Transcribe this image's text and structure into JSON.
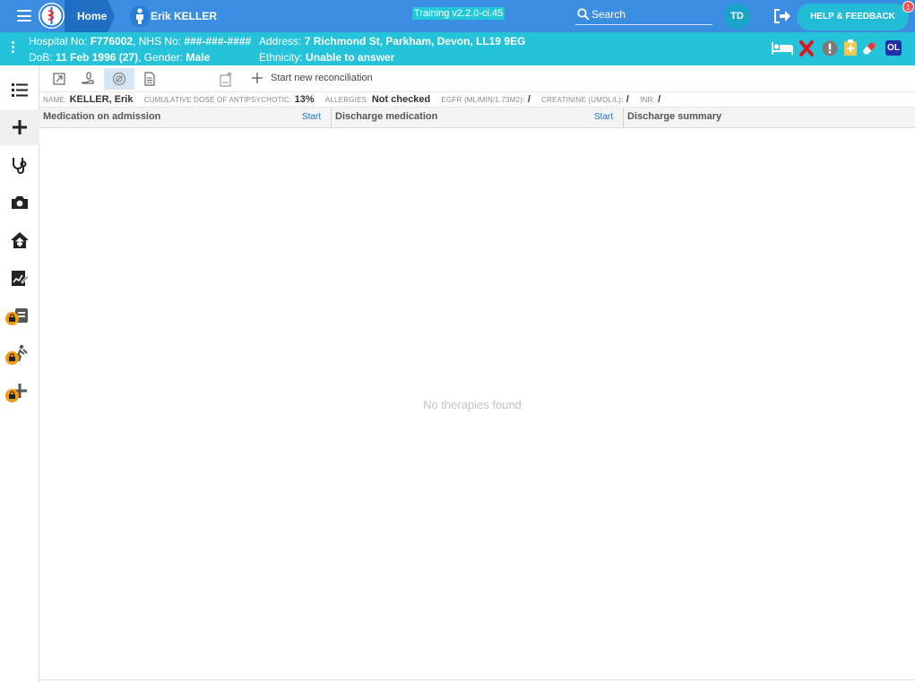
{
  "header": {
    "home_label": "Home",
    "patient_name": "Erik KELLER",
    "training_label": "Training v2.2.0-ci.45",
    "search_label": "Search",
    "user_initials": "TD",
    "help_label": "HELP & FEEDBACK",
    "help_badge_count": "1"
  },
  "banner": {
    "hospital_label": "Hospital No:",
    "hospital_no": "F776002",
    "nhs_label": "NHS No:",
    "nhs_no": "###-###-####",
    "dob_label": "DoB:",
    "dob": "11 Feb 1996 (27)",
    "gender_label": "Gender:",
    "gender": "Male",
    "address_label": "Address:",
    "address": "7 Richmond St, Parkham, Devon, LL19 9EG",
    "ethnicity_label": "Ethnicity:",
    "ethnicity": "Unable to answer",
    "ol_label": "OL"
  },
  "toolbar": {
    "start_recon_label": "Start new reconciliation"
  },
  "info": {
    "name_label": "NAME:",
    "name": "KELLER, Erik",
    "dose_label": "CUMULATIVE DOSE OF ANTIPSYCHOTIC:",
    "dose": "13%",
    "allergies_label": "ALLERGIES:",
    "allergies": "Not checked",
    "egfr_label": "EGFR (ML/MIN/1.73M2):",
    "egfr": "/",
    "creat_label": "CREATININE (UMOL/L):",
    "creat": "/",
    "inr_label": "INR:",
    "inr": "/"
  },
  "columns": {
    "admission_title": "Medication on admission",
    "admission_start": "Start",
    "discharge_title": "Discharge medication",
    "discharge_start": "Start",
    "summary_title": "Discharge summary"
  },
  "main": {
    "empty_message": "No therapies found"
  },
  "colors": {
    "topbar": "#3a8de0",
    "banner": "#25c3da",
    "accent": "#22bcd6",
    "lock": "#f39a0d"
  }
}
